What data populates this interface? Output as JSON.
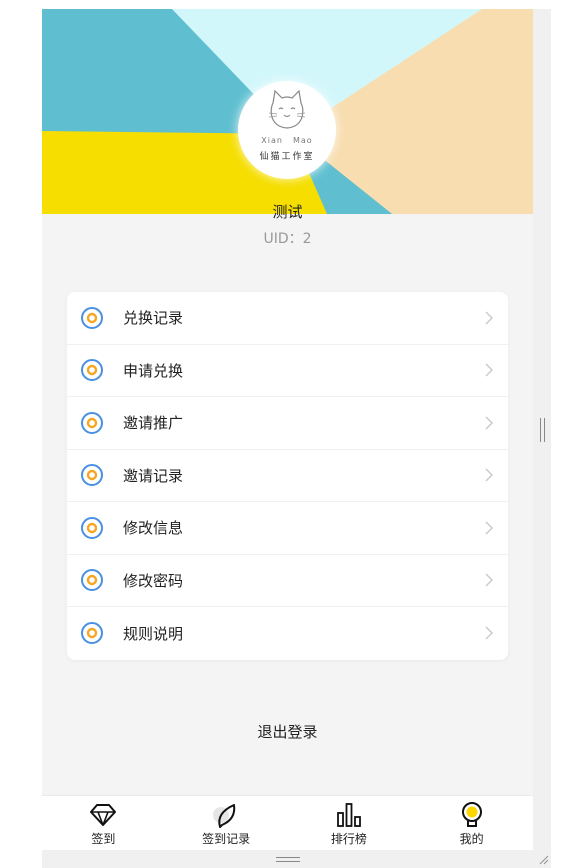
{
  "profile": {
    "logo_en_1": "Xian",
    "logo_en_2": "Mao",
    "logo_cn": "仙猫工作室",
    "username": "测试",
    "uid": "UID：2"
  },
  "menu": {
    "items": [
      {
        "label": "兑换记录"
      },
      {
        "label": "申请兑换"
      },
      {
        "label": "邀请推广"
      },
      {
        "label": "邀请记录"
      },
      {
        "label": "修改信息"
      },
      {
        "label": "修改密码"
      },
      {
        "label": "规则说明"
      }
    ]
  },
  "logout_label": "退出登录",
  "tabbar": {
    "tabs": [
      {
        "label": "签到",
        "icon": "diamond-icon"
      },
      {
        "label": "签到记录",
        "icon": "leaf-icon"
      },
      {
        "label": "排行榜",
        "icon": "bar-chart-icon"
      },
      {
        "label": "我的",
        "icon": "lightbulb-icon"
      }
    ]
  },
  "colors": {
    "banner_teal": "#5fbfd0",
    "banner_light_cyan": "#d2f7fb",
    "banner_peach": "#f8ddb0",
    "banner_yellow": "#f5de00",
    "icon_blue": "#4a90e2",
    "icon_orange": "#f5a623",
    "bulb_yellow": "#ffd700"
  }
}
